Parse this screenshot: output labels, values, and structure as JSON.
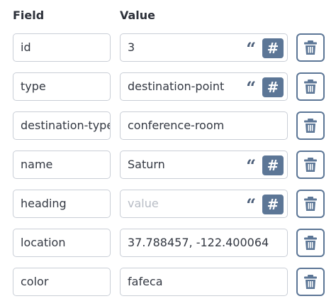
{
  "headers": {
    "field": "Field",
    "value": "Value"
  },
  "rows": [
    {
      "key": "id",
      "value": "3",
      "placeholder": "",
      "type_toggle": true
    },
    {
      "key": "type",
      "value": "destination-point",
      "placeholder": "",
      "type_toggle": true
    },
    {
      "key": "destination-type",
      "value": "conference-room",
      "placeholder": "",
      "type_toggle": false
    },
    {
      "key": "name",
      "value": "Saturn",
      "placeholder": "",
      "type_toggle": true
    },
    {
      "key": "heading",
      "value": "",
      "placeholder": "value",
      "type_toggle": true
    },
    {
      "key": "location",
      "value": "37.788457, -122.400064",
      "placeholder": "",
      "type_toggle": false
    },
    {
      "key": "color",
      "value": "fafeca",
      "placeholder": "",
      "type_toggle": false
    }
  ],
  "icons": {
    "string_type": "quote-icon",
    "number_type": "hash-icon",
    "delete": "trash-icon"
  },
  "colors": {
    "accent": "#5c7696",
    "border": "#c9ced6",
    "placeholder": "#b7bcc5"
  }
}
